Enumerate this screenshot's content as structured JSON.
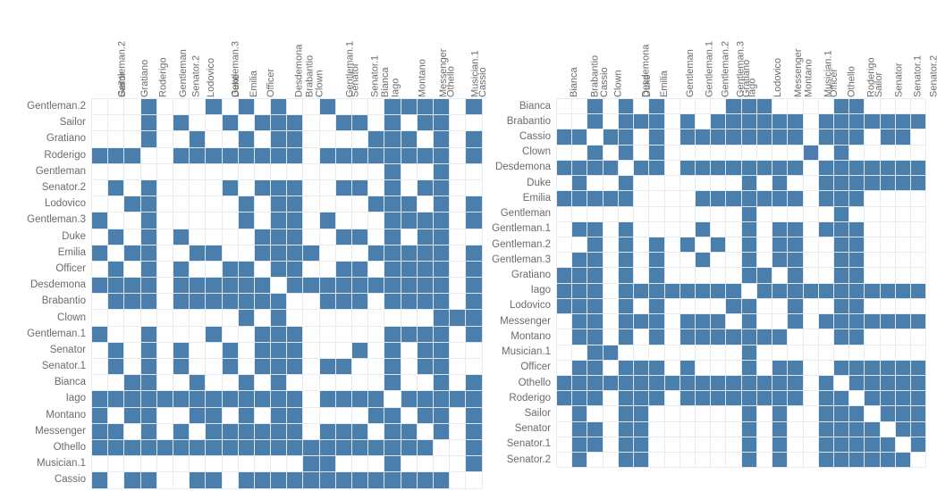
{
  "figure": {
    "kind": "two-panel-binary-matrix",
    "accent_color": "#4a7fad",
    "empty_color": "#ffffff",
    "grid_line_color": "#e9edf2",
    "label_color": "#6b6b6b",
    "background": "#ffffff"
  },
  "chart_data": [
    {
      "type": "heatmap",
      "title": "",
      "subtitle": "",
      "xlabel": "",
      "ylabel": "",
      "grid": true,
      "legend": "none",
      "value_scale": "binary (0 = white, 1 = blue)",
      "order": "clustered",
      "categories": [
        "Gentleman.2",
        "Sailor",
        "Gratiano",
        "Roderigo",
        "Gentleman",
        "Senator.2",
        "Lodovico",
        "Gentleman.3",
        "Duke",
        "Emilia",
        "Officer",
        "Desdemona",
        "Brabantio",
        "Clown",
        "Gentleman.1",
        "Senator",
        "Senator.1",
        "Bianca",
        "Iago",
        "Montano",
        "Messenger",
        "Othello",
        "Musician.1",
        "Cassio"
      ],
      "xtick_labels": [
        "Gentleman.2",
        "Sailor",
        "Gratiano",
        "Roderigo",
        "Gentleman",
        "Senator.2",
        "Lodovico",
        "Gentleman.3",
        "Duke",
        "Emilia",
        "Officer",
        "Desdemona",
        "Brabantio",
        "Clown",
        "Gentleman.1",
        "Senator",
        "Senator.1",
        "Bianca",
        "Iago",
        "Montano",
        "Messenger",
        "Othello",
        "Musician.1",
        "Cassio"
      ],
      "ytick_labels": [
        "Gentleman.2",
        "Sailor",
        "Gratiano",
        "Roderigo",
        "Gentleman",
        "Senator.2",
        "Lodovico",
        "Gentleman.3",
        "Duke",
        "Emilia",
        "Officer",
        "Desdemona",
        "Brabantio",
        "Clown",
        "Gentleman.1",
        "Senator",
        "Senator.1",
        "Bianca",
        "Iago",
        "Montano",
        "Messenger",
        "Othello",
        "Musician.1",
        "Cassio"
      ],
      "values": [
        [
          0,
          0,
          0,
          1,
          0,
          0,
          0,
          1,
          0,
          1,
          0,
          1,
          0,
          0,
          1,
          0,
          0,
          0,
          1,
          1,
          1,
          1,
          0,
          1
        ],
        [
          0,
          0,
          0,
          1,
          0,
          1,
          0,
          0,
          1,
          0,
          1,
          1,
          1,
          0,
          0,
          1,
          1,
          0,
          1,
          0,
          1,
          1,
          0,
          0
        ],
        [
          0,
          0,
          0,
          1,
          0,
          0,
          1,
          0,
          0,
          1,
          0,
          1,
          1,
          0,
          0,
          0,
          0,
          1,
          1,
          1,
          0,
          1,
          0,
          1
        ],
        [
          1,
          1,
          1,
          0,
          0,
          1,
          1,
          1,
          1,
          1,
          1,
          1,
          1,
          0,
          1,
          1,
          1,
          1,
          1,
          1,
          1,
          1,
          0,
          1
        ],
        [
          0,
          0,
          0,
          0,
          0,
          0,
          0,
          0,
          0,
          0,
          0,
          0,
          0,
          0,
          0,
          0,
          0,
          0,
          1,
          0,
          0,
          1,
          0,
          0
        ],
        [
          0,
          1,
          0,
          1,
          0,
          0,
          0,
          0,
          1,
          0,
          1,
          1,
          1,
          0,
          0,
          1,
          1,
          0,
          1,
          0,
          1,
          1,
          0,
          0
        ],
        [
          0,
          0,
          1,
          1,
          0,
          0,
          0,
          0,
          0,
          1,
          0,
          1,
          1,
          0,
          0,
          0,
          0,
          1,
          1,
          1,
          0,
          1,
          0,
          1
        ],
        [
          1,
          0,
          0,
          1,
          0,
          0,
          0,
          0,
          0,
          1,
          0,
          1,
          1,
          0,
          1,
          0,
          0,
          0,
          1,
          1,
          1,
          1,
          0,
          1
        ],
        [
          0,
          1,
          0,
          1,
          0,
          1,
          0,
          0,
          0,
          0,
          1,
          1,
          1,
          0,
          0,
          1,
          1,
          0,
          1,
          0,
          1,
          1,
          0,
          0
        ],
        [
          1,
          0,
          1,
          1,
          0,
          0,
          1,
          1,
          0,
          0,
          1,
          1,
          1,
          1,
          0,
          0,
          0,
          1,
          1,
          1,
          1,
          1,
          0,
          1
        ],
        [
          0,
          1,
          0,
          1,
          0,
          1,
          0,
          0,
          1,
          1,
          0,
          1,
          1,
          0,
          0,
          1,
          1,
          0,
          1,
          1,
          1,
          1,
          0,
          1
        ],
        [
          1,
          1,
          1,
          1,
          0,
          1,
          1,
          1,
          1,
          1,
          1,
          0,
          1,
          1,
          1,
          1,
          1,
          1,
          1,
          1,
          1,
          1,
          0,
          1
        ],
        [
          0,
          1,
          1,
          1,
          0,
          1,
          1,
          1,
          1,
          1,
          1,
          1,
          0,
          0,
          1,
          1,
          1,
          0,
          1,
          1,
          1,
          1,
          0,
          1
        ],
        [
          0,
          0,
          0,
          0,
          0,
          0,
          0,
          0,
          0,
          1,
          0,
          1,
          0,
          0,
          0,
          0,
          0,
          0,
          0,
          0,
          0,
          1,
          1,
          1
        ],
        [
          1,
          0,
          0,
          1,
          0,
          0,
          0,
          1,
          0,
          0,
          1,
          1,
          1,
          0,
          0,
          0,
          0,
          0,
          1,
          1,
          1,
          1,
          0,
          1
        ],
        [
          0,
          1,
          0,
          1,
          0,
          1,
          0,
          0,
          1,
          0,
          1,
          1,
          1,
          0,
          0,
          0,
          1,
          0,
          1,
          0,
          1,
          1,
          0,
          0
        ],
        [
          0,
          1,
          0,
          1,
          0,
          1,
          0,
          0,
          1,
          0,
          1,
          1,
          1,
          0,
          1,
          1,
          0,
          0,
          1,
          0,
          1,
          1,
          0,
          0
        ],
        [
          0,
          0,
          1,
          1,
          0,
          0,
          1,
          0,
          0,
          1,
          0,
          1,
          0,
          0,
          0,
          0,
          0,
          0,
          1,
          0,
          0,
          1,
          0,
          1
        ],
        [
          1,
          1,
          1,
          1,
          1,
          1,
          1,
          1,
          1,
          1,
          1,
          1,
          1,
          0,
          1,
          1,
          1,
          1,
          0,
          1,
          1,
          1,
          1,
          1
        ],
        [
          1,
          0,
          1,
          1,
          0,
          0,
          1,
          1,
          0,
          1,
          0,
          1,
          1,
          0,
          0,
          0,
          0,
          1,
          1,
          0,
          1,
          1,
          0,
          1
        ],
        [
          1,
          1,
          0,
          1,
          0,
          1,
          0,
          1,
          1,
          1,
          1,
          1,
          1,
          0,
          1,
          1,
          1,
          0,
          1,
          1,
          0,
          1,
          0,
          1
        ],
        [
          1,
          1,
          1,
          1,
          1,
          1,
          1,
          1,
          1,
          1,
          1,
          1,
          1,
          1,
          1,
          1,
          1,
          1,
          1,
          1,
          1,
          0,
          0,
          1
        ],
        [
          0,
          0,
          0,
          0,
          0,
          0,
          0,
          0,
          0,
          0,
          0,
          0,
          0,
          1,
          1,
          0,
          0,
          0,
          1,
          0,
          0,
          0,
          0,
          1
        ],
        [
          1,
          0,
          1,
          1,
          0,
          0,
          1,
          1,
          0,
          1,
          1,
          1,
          1,
          1,
          1,
          1,
          1,
          1,
          1,
          1,
          1,
          1,
          0,
          0
        ]
      ]
    },
    {
      "type": "heatmap",
      "title": "",
      "subtitle": "",
      "xlabel": "",
      "ylabel": "",
      "grid": true,
      "legend": "none",
      "value_scale": "binary (0 = white, 1 = blue)",
      "order": "alphabetical",
      "categories": [
        "Bianca",
        "Brabantio",
        "Cassio",
        "Clown",
        "Desdemona",
        "Duke",
        "Emilia",
        "Gentleman",
        "Gentleman.1",
        "Gentleman.2",
        "Gentleman.3",
        "Gratiano",
        "Iago",
        "Lodovico",
        "Messenger",
        "Montano",
        "Musician.1",
        "Officer",
        "Othello",
        "Roderigo",
        "Sailor",
        "Senator",
        "Senator.1",
        "Senator.2"
      ],
      "xtick_labels": [
        "Bianca",
        "Brabantio",
        "Cassio",
        "Clown",
        "Desdemona",
        "Duke",
        "Emilia",
        "Gentleman",
        "Gentleman.1",
        "Gentleman.2",
        "Gentleman.3",
        "Gratiano",
        "Iago",
        "Lodovico",
        "Messenger",
        "Montano",
        "Musician.1",
        "Officer",
        "Othello",
        "Roderigo",
        "Sailor",
        "Senator",
        "Senator.1",
        "Senator.2"
      ],
      "ytick_labels": [
        "Bianca",
        "Brabantio",
        "Cassio",
        "Clown",
        "Desdemona",
        "Duke",
        "Emilia",
        "Gentleman",
        "Gentleman.1",
        "Gentleman.2",
        "Gentleman.3",
        "Gratiano",
        "Iago",
        "Lodovico",
        "Messenger",
        "Montano",
        "Musician.1",
        "Officer",
        "Othello",
        "Roderigo",
        "Sailor",
        "Senator",
        "Senator.1",
        "Senator.2"
      ],
      "values": [
        [
          0,
          0,
          1,
          0,
          1,
          0,
          1,
          0,
          0,
          0,
          0,
          1,
          1,
          1,
          0,
          0,
          0,
          0,
          1,
          1,
          0,
          0,
          0,
          0
        ],
        [
          0,
          0,
          1,
          0,
          1,
          1,
          1,
          0,
          1,
          0,
          1,
          1,
          1,
          1,
          1,
          1,
          0,
          1,
          1,
          1,
          1,
          1,
          1,
          1
        ],
        [
          1,
          1,
          0,
          1,
          1,
          0,
          1,
          0,
          1,
          1,
          1,
          1,
          1,
          1,
          1,
          1,
          0,
          1,
          1,
          1,
          0,
          1,
          1,
          0
        ],
        [
          0,
          0,
          1,
          0,
          1,
          0,
          1,
          0,
          0,
          0,
          0,
          0,
          0,
          0,
          0,
          0,
          1,
          0,
          1,
          0,
          0,
          0,
          0,
          0
        ],
        [
          1,
          1,
          1,
          1,
          0,
          1,
          1,
          0,
          1,
          1,
          1,
          1,
          1,
          1,
          1,
          1,
          0,
          1,
          1,
          1,
          1,
          1,
          1,
          1
        ],
        [
          0,
          1,
          0,
          0,
          1,
          0,
          0,
          0,
          0,
          0,
          0,
          0,
          1,
          0,
          1,
          0,
          0,
          1,
          1,
          1,
          1,
          1,
          1,
          1
        ],
        [
          1,
          1,
          1,
          1,
          1,
          0,
          0,
          0,
          0,
          1,
          1,
          1,
          1,
          1,
          1,
          1,
          0,
          1,
          1,
          1,
          0,
          0,
          0,
          0
        ],
        [
          0,
          0,
          0,
          0,
          0,
          0,
          0,
          0,
          0,
          0,
          0,
          0,
          1,
          0,
          0,
          0,
          0,
          0,
          1,
          0,
          0,
          0,
          0,
          0
        ],
        [
          0,
          1,
          1,
          0,
          1,
          0,
          0,
          0,
          0,
          1,
          0,
          0,
          1,
          0,
          1,
          1,
          0,
          1,
          1,
          1,
          0,
          0,
          0,
          0
        ],
        [
          0,
          0,
          1,
          0,
          1,
          0,
          1,
          0,
          1,
          0,
          1,
          0,
          1,
          0,
          1,
          1,
          0,
          0,
          1,
          1,
          0,
          0,
          0,
          0
        ],
        [
          0,
          1,
          1,
          0,
          1,
          0,
          1,
          0,
          0,
          1,
          0,
          0,
          1,
          0,
          1,
          1,
          0,
          0,
          1,
          1,
          0,
          0,
          0,
          0
        ],
        [
          1,
          1,
          1,
          0,
          1,
          0,
          1,
          0,
          0,
          0,
          0,
          0,
          1,
          1,
          0,
          1,
          0,
          0,
          1,
          1,
          0,
          0,
          0,
          0
        ],
        [
          1,
          1,
          1,
          0,
          1,
          1,
          1,
          1,
          1,
          1,
          1,
          1,
          0,
          1,
          1,
          1,
          1,
          1,
          1,
          1,
          1,
          1,
          1,
          1
        ],
        [
          1,
          1,
          1,
          0,
          1,
          0,
          1,
          0,
          0,
          0,
          0,
          1,
          1,
          0,
          0,
          1,
          0,
          0,
          1,
          1,
          0,
          0,
          0,
          0
        ],
        [
          0,
          1,
          1,
          0,
          1,
          1,
          1,
          0,
          1,
          1,
          1,
          0,
          1,
          0,
          0,
          1,
          0,
          1,
          1,
          1,
          1,
          1,
          1,
          1
        ],
        [
          0,
          1,
          1,
          0,
          1,
          0,
          1,
          0,
          1,
          1,
          1,
          1,
          1,
          1,
          1,
          0,
          0,
          0,
          1,
          1,
          0,
          0,
          0,
          0
        ],
        [
          0,
          0,
          1,
          1,
          0,
          0,
          0,
          0,
          0,
          0,
          0,
          0,
          1,
          0,
          0,
          0,
          0,
          0,
          0,
          0,
          0,
          0,
          0,
          0
        ],
        [
          0,
          1,
          1,
          0,
          1,
          1,
          1,
          0,
          1,
          0,
          0,
          0,
          1,
          0,
          1,
          1,
          0,
          0,
          1,
          1,
          1,
          1,
          1,
          1
        ],
        [
          1,
          1,
          1,
          1,
          1,
          1,
          1,
          1,
          1,
          1,
          1,
          1,
          1,
          1,
          1,
          1,
          0,
          1,
          0,
          1,
          1,
          1,
          1,
          1
        ],
        [
          1,
          1,
          1,
          0,
          1,
          1,
          1,
          0,
          1,
          1,
          1,
          1,
          1,
          1,
          1,
          1,
          0,
          1,
          1,
          0,
          1,
          1,
          1,
          1
        ],
        [
          0,
          1,
          0,
          0,
          1,
          1,
          0,
          0,
          0,
          0,
          0,
          0,
          1,
          0,
          1,
          0,
          0,
          1,
          1,
          1,
          0,
          1,
          1,
          1
        ],
        [
          0,
          1,
          1,
          0,
          1,
          1,
          0,
          0,
          0,
          0,
          0,
          0,
          1,
          0,
          1,
          0,
          0,
          1,
          1,
          1,
          1,
          0,
          1,
          1
        ],
        [
          0,
          1,
          1,
          0,
          1,
          1,
          0,
          0,
          0,
          0,
          0,
          0,
          1,
          0,
          1,
          0,
          0,
          1,
          1,
          1,
          1,
          1,
          0,
          1
        ],
        [
          0,
          1,
          0,
          0,
          1,
          1,
          0,
          0,
          0,
          0,
          0,
          0,
          1,
          0,
          1,
          0,
          0,
          1,
          1,
          1,
          1,
          1,
          1,
          0
        ]
      ]
    }
  ]
}
